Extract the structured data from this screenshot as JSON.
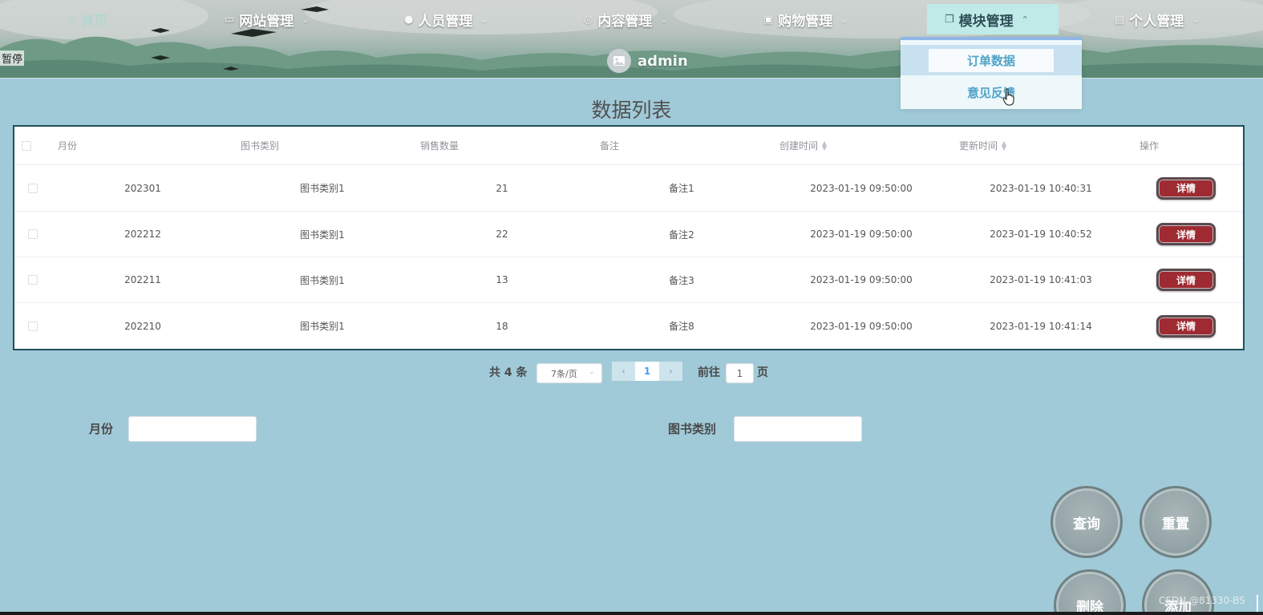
{
  "header": {
    "paused_text": "暂停",
    "username": "admin",
    "nav": [
      {
        "label": "首页",
        "icon": "home-icon"
      },
      {
        "label": "网站管理",
        "icon": "monitor-icon"
      },
      {
        "label": "人员管理",
        "icon": "user-icon"
      },
      {
        "label": "内容管理",
        "icon": "compass-icon"
      },
      {
        "label": "购物管理",
        "icon": "lock-icon"
      },
      {
        "label": "模块管理",
        "icon": "copy-icon"
      },
      {
        "label": "个人管理",
        "icon": "document-icon"
      }
    ],
    "dropdown": [
      "订单数据",
      "意见反馈"
    ]
  },
  "main": {
    "title": "数据列表"
  },
  "table": {
    "headers": [
      "月份",
      "图书类别",
      "销售数量",
      "备注",
      "创建时间",
      "更新时间",
      "操作"
    ],
    "detail_label": "详情",
    "rows": [
      [
        "202301",
        "图书类别1",
        "21",
        "备注1",
        "2023-01-19 09:50:00",
        "2023-01-19 10:40:31"
      ],
      [
        "202212",
        "图书类别1",
        "22",
        "备注2",
        "2023-01-19 09:50:00",
        "2023-01-19 10:40:52"
      ],
      [
        "202211",
        "图书类别1",
        "13",
        "备注3",
        "2023-01-19 09:50:00",
        "2023-01-19 10:41:03"
      ],
      [
        "202210",
        "图书类别1",
        "18",
        "备注8",
        "2023-01-19 09:50:00",
        "2023-01-19 10:41:14"
      ]
    ]
  },
  "pagination": {
    "total": "共 4 条",
    "page_size": "7条/页",
    "prev": "‹",
    "current_page": "1",
    "next": "›",
    "goto_label": "前往",
    "goto_value": "1",
    "page_label": "页"
  },
  "search": {
    "month_label": "月份",
    "category_label": "图书类别"
  },
  "actions": {
    "query": "查询",
    "reset": "重置",
    "delete": "删除",
    "add": "添加"
  },
  "watermark": "CSDN @81330-BS",
  "colors": {
    "background": "#a1cad8",
    "detail_button": "#9e2a32",
    "active_nav": "#c0eae8",
    "dropdown_text": "#4fa3c8",
    "pager_active": "#409eff"
  }
}
